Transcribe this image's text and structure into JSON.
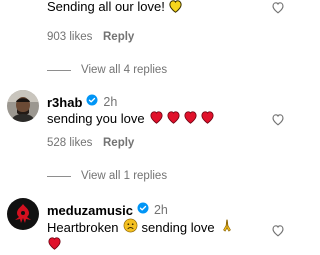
{
  "comments": [
    {
      "text": "Sending all our love!",
      "emoji": "yellow-heart-icon",
      "likes": "903 likes",
      "reply_label": "Reply"
    },
    {
      "username": "r3hab",
      "verified_icon": "verified-badge-icon",
      "time": "2h",
      "text": "sending you love",
      "emoji": [
        "red-heart-icon",
        "red-heart-icon",
        "red-heart-icon",
        "red-heart-icon"
      ],
      "likes": "528 likes",
      "reply_label": "Reply"
    },
    {
      "username": "meduzamusic",
      "verified_icon": "verified-badge-icon",
      "time": "2h",
      "text_before": "Heartbroken",
      "text_after": "sending love",
      "emoji": [
        "frowning-face-icon",
        "folded-hands-icon",
        "red-heart-icon"
      ]
    }
  ],
  "view_replies": [
    {
      "label": "View all 4 replies"
    },
    {
      "label": "View all 1 replies"
    }
  ],
  "colors": {
    "verified": "#0095f6",
    "heart": "#ed4956",
    "yellow_heart": "#f7d51c",
    "meta": "#737373"
  }
}
